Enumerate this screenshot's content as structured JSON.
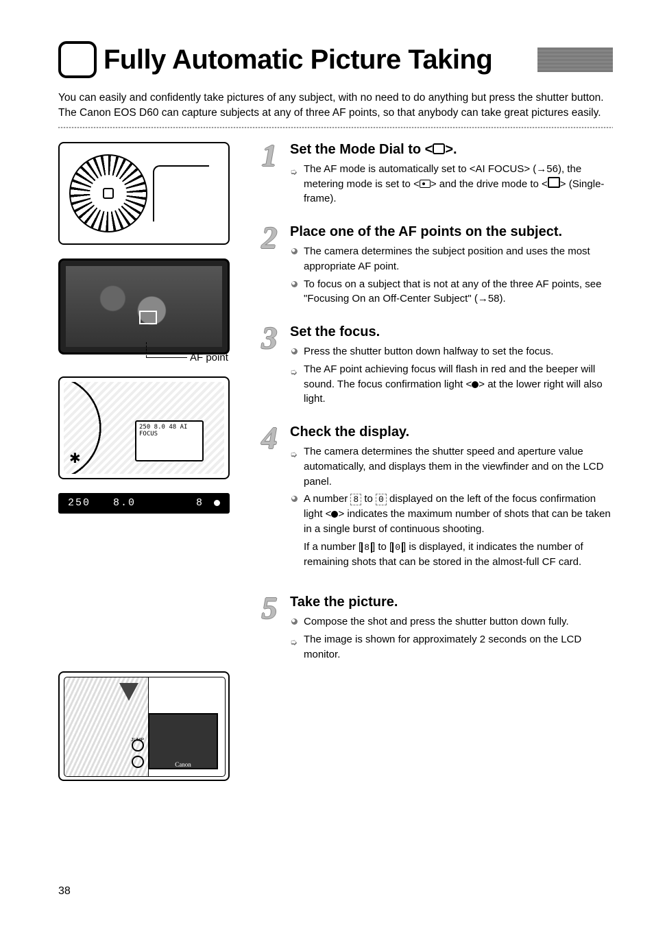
{
  "page_number": "38",
  "title": "Fully Automatic Picture Taking",
  "intro": "You can easily and confidently take pictures of any subject, with no need to do anything but press the shutter button. The Canon EOS D60 can capture subjects at any of three AF points, so that anybody can take great pictures easily.",
  "af_point_label": "AF point",
  "lcd_strip": {
    "shutter": "250",
    "aperture": "8.0",
    "burst": "8"
  },
  "camera_lcd_lines": "250  8.0\n       48\nAI FOCUS",
  "back_lcd_brand": "Canon",
  "back_btn_labels": [
    "JUMP",
    ""
  ],
  "steps": [
    {
      "num": "1",
      "title_pre": "Set the Mode Dial to <",
      "title_post": ">.",
      "items": [
        {
          "type": "arrow",
          "text": "The AF mode is automatically set to <AI FOCUS> (→56), the metering mode is set to <",
          "text2": "> and the drive mode to <",
          "text3": "> (Single-frame)."
        }
      ]
    },
    {
      "num": "2",
      "title": "Place one of the AF points on the subject.",
      "items": [
        {
          "type": "disc",
          "text": "The camera determines the subject position and uses the most appropriate AF point."
        },
        {
          "type": "disc",
          "text": "To focus on a subject that is not at any of the three AF points, see \"Focusing On an Off-Center Subject\" (→58)."
        }
      ]
    },
    {
      "num": "3",
      "title": "Set the focus.",
      "items": [
        {
          "type": "disc",
          "text": "Press the shutter button down halfway to set the focus."
        },
        {
          "type": "arrow",
          "text": "The AF point achieving focus will flash in red and the beeper will sound. The focus confirmation light <",
          "text2": "> at the lower right will also light."
        }
      ]
    },
    {
      "num": "4",
      "title": "Check the display.",
      "items": [
        {
          "type": "arrow",
          "text": "The camera determines the shutter speed and aperture value automatically, and displays them in the viewfinder and on the LCD panel."
        },
        {
          "type": "disc",
          "text_a": "A number ",
          "seg1": "8",
          "text_b": " to ",
          "seg2": "0",
          "text_c": " displayed on the left of the focus confirmation light <",
          "text_d": "> indicates the maximum number of shots that can be taken in a single burst of continuous shooting."
        }
      ],
      "para": {
        "pre": "If a number [",
        "s1": "8",
        "mid": "] to [",
        "s2": "0",
        "post": "] is displayed, it indicates the number of remaining shots that can be stored in the almost-full CF card."
      }
    },
    {
      "num": "5",
      "title": "Take the picture.",
      "items": [
        {
          "type": "disc",
          "text": "Compose the shot and press the shutter button down fully."
        },
        {
          "type": "arrow",
          "text": "The image is shown for approximately 2 seconds on the LCD monitor."
        }
      ]
    }
  ]
}
